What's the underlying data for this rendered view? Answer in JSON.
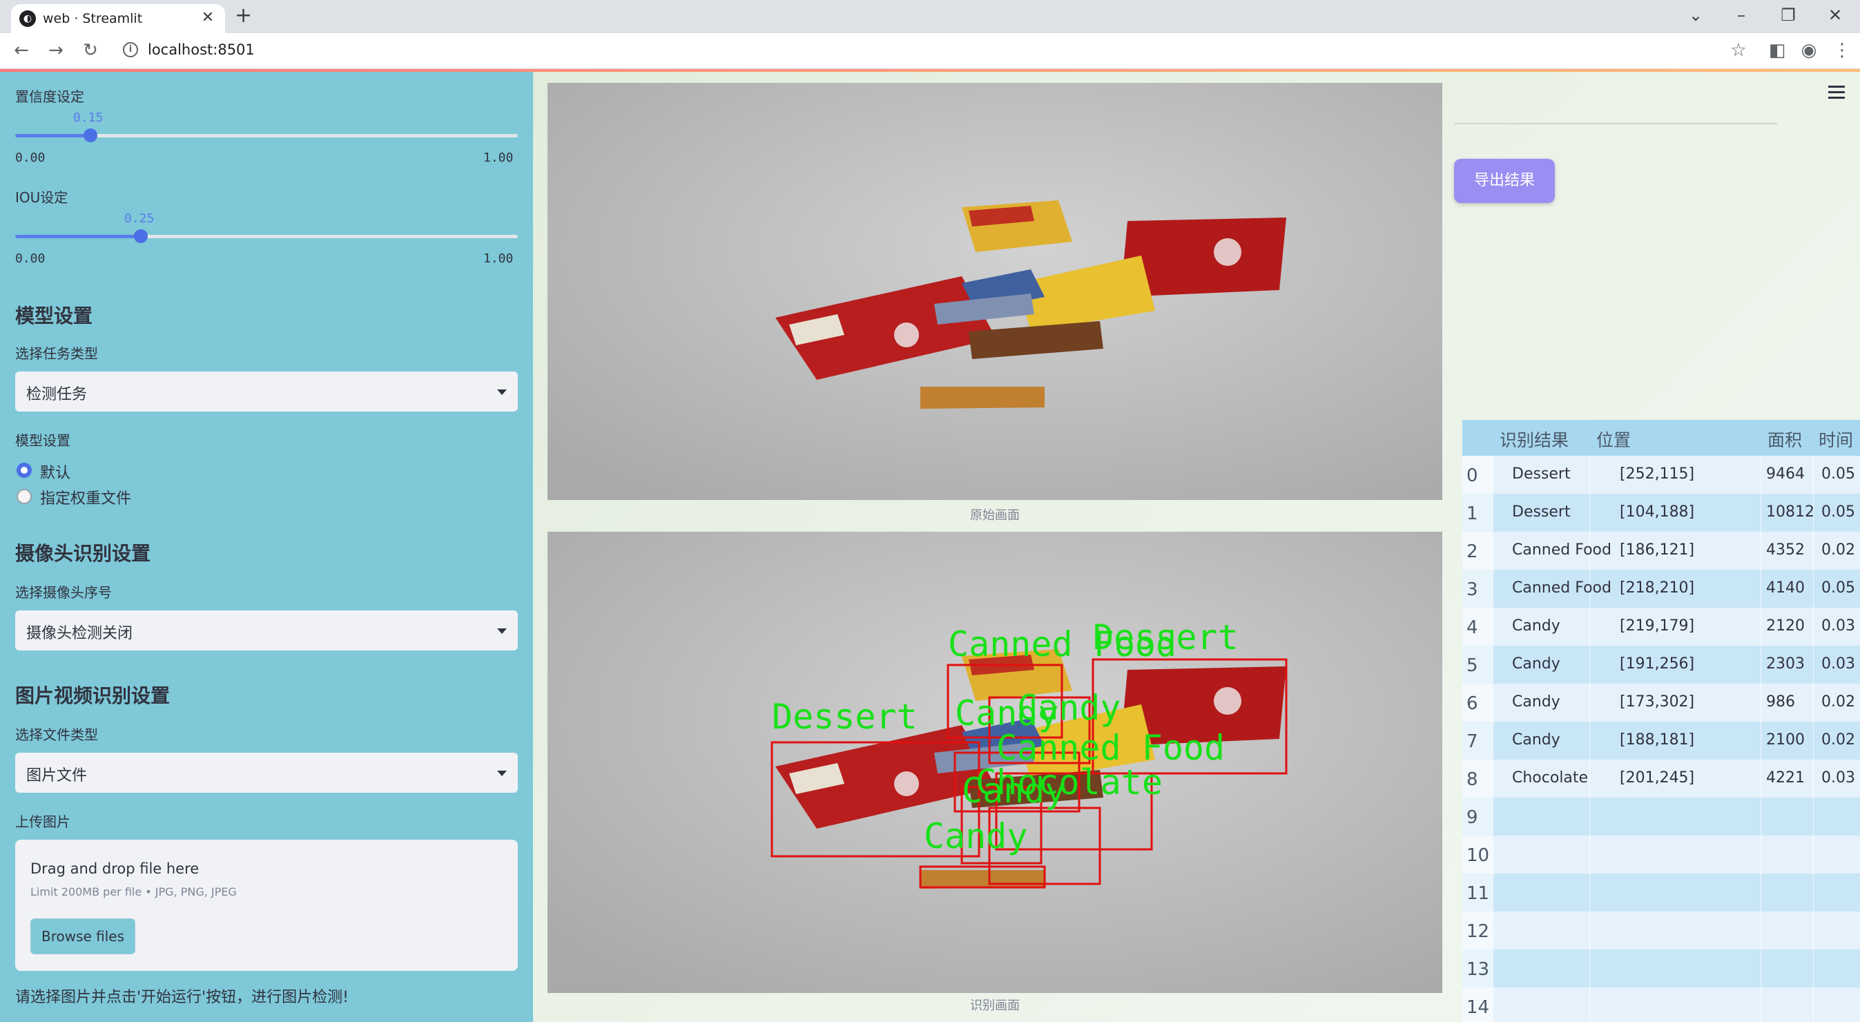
{
  "browser": {
    "tab_title": "web · Streamlit",
    "url": "localhost:8501"
  },
  "sidebar": {
    "confidence": {
      "label": "置信度设定",
      "value": "0.15",
      "min": "0.00",
      "max": "1.00",
      "fraction": 0.15
    },
    "iou": {
      "label": "IOU设定",
      "value": "0.25",
      "min": "0.00",
      "max": "1.00",
      "fraction": 0.25
    },
    "model_section_title": "模型设置",
    "task_type_label": "选择任务类型",
    "task_type_value": "检测任务",
    "model_settings_label": "模型设置",
    "model_options": [
      {
        "label": "默认",
        "selected": true
      },
      {
        "label": "指定权重文件",
        "selected": false
      }
    ],
    "camera_section_title": "摄像头识别设置",
    "camera_label": "选择摄像头序号",
    "camera_value": "摄像头检测关闭",
    "media_section_title": "图片视频识别设置",
    "file_type_label": "选择文件类型",
    "file_type_value": "图片文件",
    "upload_label": "上传图片",
    "uploader": {
      "title": "Drag and drop file here",
      "limit": "Limit 200MB per file • JPG, PNG, JPEG",
      "button": "Browse files"
    },
    "hint": "请选择图片并点击'开始运行'按钮，进行图片检测!"
  },
  "main": {
    "original_caption": "原始画面",
    "result_caption": "识别画面",
    "export_button": "导出结果",
    "detection_labels": [
      "Canned Food",
      "Dessert",
      "Dessert",
      "Candy",
      "Candy",
      "Canned Food",
      "Chocolate",
      "Candy",
      "Candy"
    ]
  },
  "table": {
    "columns": [
      "识别结果",
      "位置",
      "面积",
      "时间"
    ],
    "rows": [
      {
        "idx": "0",
        "result": "Dessert",
        "pos": "[252,115]",
        "area": "9464",
        "time": "0.05"
      },
      {
        "idx": "1",
        "result": "Dessert",
        "pos": "[104,188]",
        "area": "10812",
        "time": "0.05"
      },
      {
        "idx": "2",
        "result": "Canned Food",
        "pos": "[186,121]",
        "area": "4352",
        "time": "0.02"
      },
      {
        "idx": "3",
        "result": "Canned Food",
        "pos": "[218,210]",
        "area": "4140",
        "time": "0.05"
      },
      {
        "idx": "4",
        "result": "Candy",
        "pos": "[219,179]",
        "area": "2120",
        "time": "0.03"
      },
      {
        "idx": "5",
        "result": "Candy",
        "pos": "[191,256]",
        "area": "2303",
        "time": "0.03"
      },
      {
        "idx": "6",
        "result": "Candy",
        "pos": "[173,302]",
        "area": "986",
        "time": "0.02"
      },
      {
        "idx": "7",
        "result": "Candy",
        "pos": "[188,181]",
        "area": "2100",
        "time": "0.02"
      },
      {
        "idx": "8",
        "result": "Chocolate",
        "pos": "[201,245]",
        "area": "4221",
        "time": "0.03"
      },
      {
        "idx": "9",
        "result": "",
        "pos": "",
        "area": "",
        "time": ""
      },
      {
        "idx": "10",
        "result": "",
        "pos": "",
        "area": "",
        "time": ""
      },
      {
        "idx": "11",
        "result": "",
        "pos": "",
        "area": "",
        "time": ""
      },
      {
        "idx": "12",
        "result": "",
        "pos": "",
        "area": "",
        "time": ""
      },
      {
        "idx": "13",
        "result": "",
        "pos": "",
        "area": "",
        "time": ""
      },
      {
        "idx": "14",
        "result": "",
        "pos": "",
        "area": "",
        "time": ""
      }
    ]
  },
  "colors": {
    "sidebar_bg": "#7ec8d8",
    "slider_accent": "#4b6fe5",
    "export_button": "#9b8ef2",
    "detection_box": "#e01010",
    "detection_text": "#18e018"
  },
  "icons": [
    "back-arrow-icon",
    "forward-arrow-icon",
    "reload-icon",
    "info-icon",
    "star-icon",
    "sidepanel-icon",
    "profile-icon",
    "kebab-menu-icon",
    "hamburger-menu-icon"
  ]
}
